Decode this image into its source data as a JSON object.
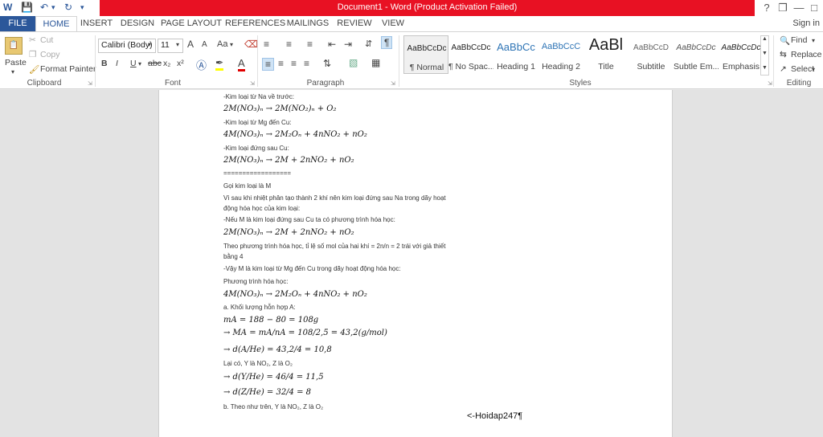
{
  "window": {
    "title": "Document1 - Word (Product Activation Failed)",
    "sign_in": "Sign in",
    "app_icon": "W"
  },
  "tabs": [
    "FILE",
    "HOME",
    "INSERT",
    "DESIGN",
    "PAGE LAYOUT",
    "REFERENCES",
    "MAILINGS",
    "REVIEW",
    "VIEW"
  ],
  "ribbon": {
    "clipboard": {
      "paste": "Paste",
      "cut": "Cut",
      "copy": "Copy",
      "format_painter": "Format Painter",
      "label": "Clipboard"
    },
    "font": {
      "name": "Calibri (Body)",
      "size": "11",
      "label": "Font",
      "bold": "B",
      "italic": "I",
      "underline": "U",
      "strike": "abc",
      "sub": "x₂",
      "sup": "x²",
      "change_case": "Aa",
      "grow": "A",
      "shrink": "A"
    },
    "paragraph": {
      "label": "Paragraph"
    },
    "styles": {
      "label": "Styles",
      "items": [
        {
          "sample": "AaBbCcDc",
          "name": "¶ Normal"
        },
        {
          "sample": "AaBbCcDc",
          "name": "¶ No Spac..."
        },
        {
          "sample": "AaBbCc",
          "name": "Heading 1"
        },
        {
          "sample": "AaBbCcC",
          "name": "Heading 2"
        },
        {
          "sample": "AaBl",
          "name": "Title"
        },
        {
          "sample": "AaBbCcD",
          "name": "Subtitle"
        },
        {
          "sample": "AaBbCcDc",
          "name": "Subtle Em..."
        },
        {
          "sample": "AaBbCcDc",
          "name": "Emphasis"
        }
      ]
    },
    "editing": {
      "find": "Find",
      "replace": "Replace",
      "select": "Select",
      "label": "Editing"
    }
  },
  "document": {
    "lines": [
      "-Kim loại từ Na về trước:",
      "2M(NO₃)ₙ → 2M(NO₂)ₙ + O₂",
      "-Kim loại từ Mg đến Cu:",
      "4M(NO₃)ₙ → 2M₂Oₙ + 4nNO₂ + nO₂",
      "-Kim loại đứng sau Cu:",
      "2M(NO₃)ₙ → 2M + 2nNO₂ + nO₂",
      "==================",
      "Gọi kim loại là M",
      "Vì sau khi nhiệt phân tạo thành 2 khí nên kim loại đứng sau Na trong dãy hoạt",
      "động hóa học của kim loại:",
      "-Nếu M là kim loại đứng sau Cu ta có phương trình hóa học:",
      "2M(NO₃)ₙ → 2M + 2nNO₂ + nO₂",
      "Theo phương trình hóa học, tỉ lệ số mol của hai khí = 2n/n = 2 trái với giả thiết",
      "bằng 4",
      "-Vậy M là kim loại từ Mg đến Cu trong dãy hoạt động hóa học:",
      "Phương trình hóa học:",
      "4M(NO₃)ₙ → 2M₂Oₙ + 4nNO₂ + nO₂",
      "a. Khối lượng hỗn hợp A:",
      "mA = 188 − 80 = 108g",
      "→ MA = mA/nA = 108/2,5 = 43,2(g/mol)",
      "→ d(A/He) = 43,2/4 = 10,8",
      "Lại có, Y là NO₂, Z là O₂",
      "→ d(Y/He) = 46/4 = 11,5",
      "→ d(Z/He) = 32/4 = 8",
      "b. Theo như trên, Y là NO₂, Z là O₂"
    ],
    "credit": "<-Hoidap247¶"
  }
}
